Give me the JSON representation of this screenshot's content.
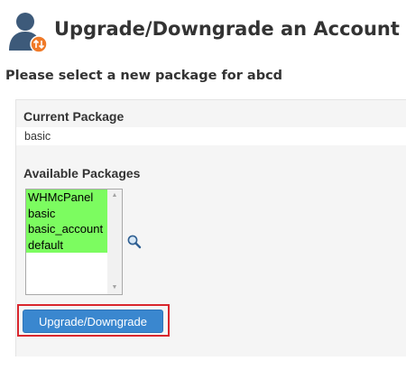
{
  "header": {
    "title": "Upgrade/Downgrade an Account",
    "icon": "user-upgrade-icon"
  },
  "subtitle": "Please select a new package for abcd",
  "current_package": {
    "label": "Current Package",
    "value": "basic"
  },
  "available_packages": {
    "label": "Available Packages",
    "options": [
      "WHMcPanel",
      "basic",
      "basic_account",
      "default"
    ],
    "highlight_color": "#7cfc60"
  },
  "actions": {
    "submit_label": "Upgrade/Downgrade",
    "accent": "#3a87cf",
    "highlight_border": "#d9262d"
  },
  "icons": {
    "search": "search-icon"
  }
}
